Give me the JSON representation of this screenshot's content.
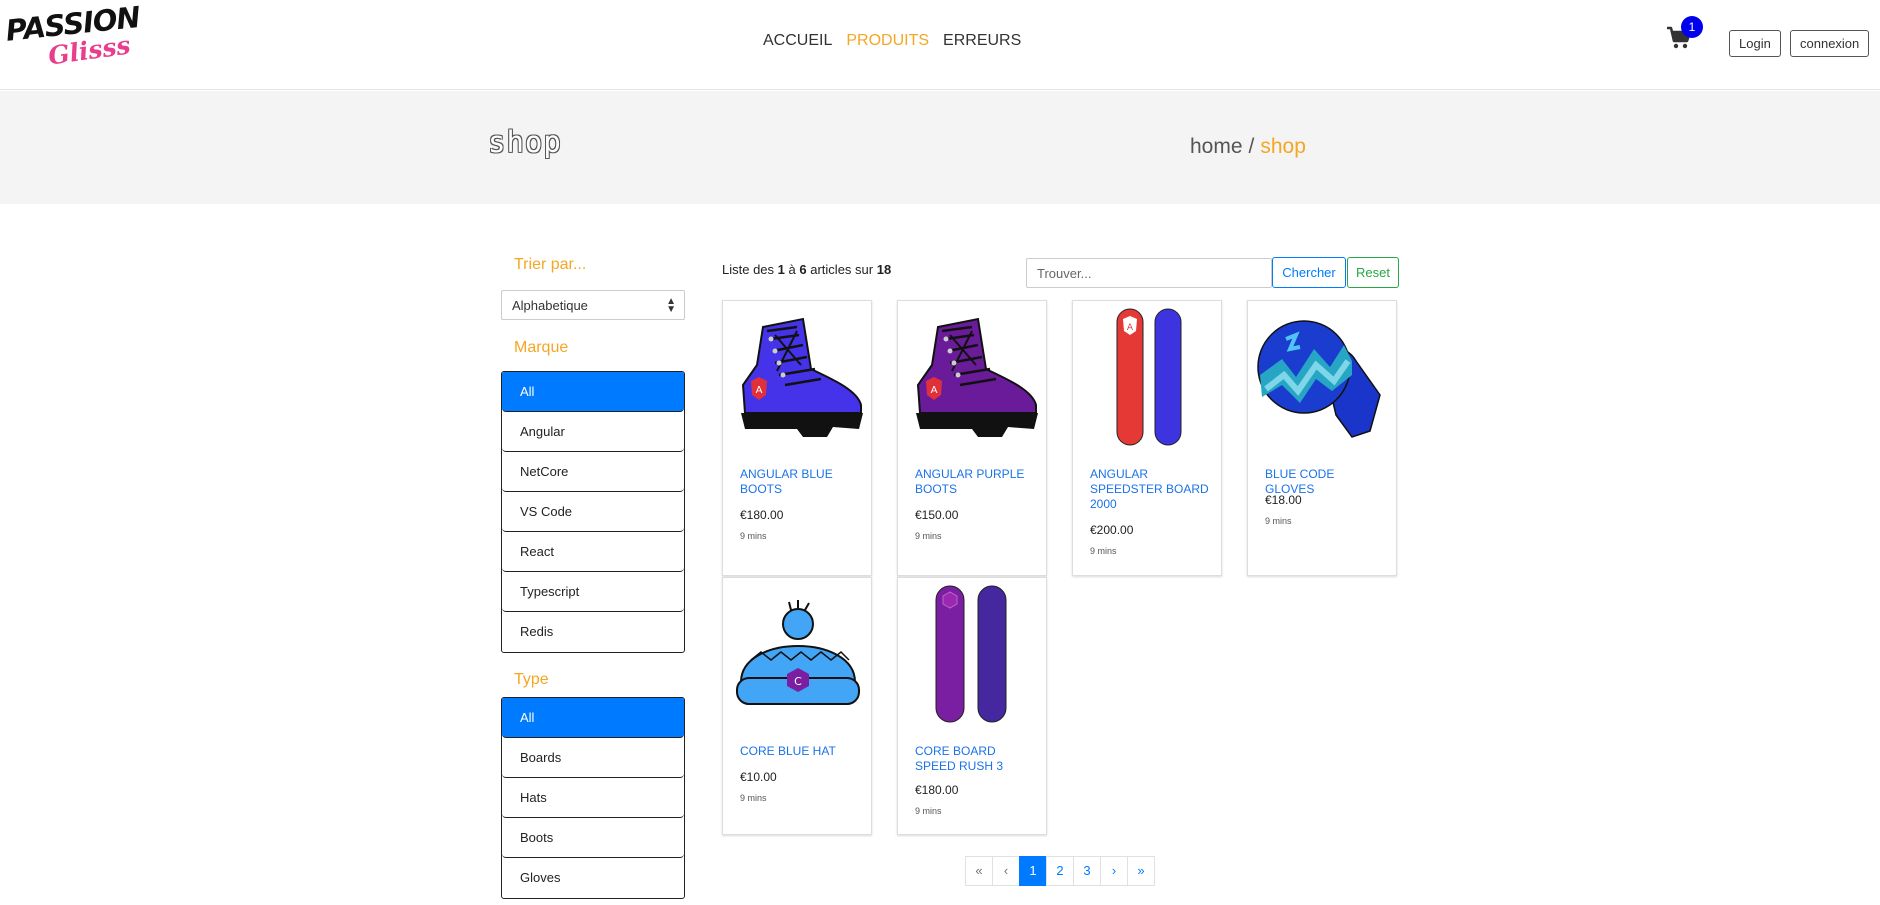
{
  "header": {
    "logo_line1": "PASSION",
    "logo_line2": "Glisss",
    "nav": [
      "ACCUEIL",
      "PRODUITS",
      "ERREURS"
    ],
    "active_nav": "PRODUITS",
    "cart_count": "1",
    "login_label": "Login",
    "connexion_label": "connexion"
  },
  "banner": {
    "title": "shop",
    "breadcrumb_home": "home",
    "breadcrumb_sep": "/",
    "breadcrumb_current": "shop"
  },
  "sidebar": {
    "sort_heading": "Trier par...",
    "sort_value": "Alphabetique",
    "brand_heading": "Marque",
    "brands": [
      "All",
      "Angular",
      "NetCore",
      "VS Code",
      "React",
      "Typescript",
      "Redis"
    ],
    "brand_selected": "All",
    "type_heading": "Type",
    "types": [
      "All",
      "Boards",
      "Hats",
      "Boots",
      "Gloves"
    ],
    "type_selected": "All"
  },
  "main": {
    "summary_prefix": "Liste des",
    "summary_from": "1",
    "summary_mid": "à",
    "summary_to": "6",
    "summary_mid2": "articles sur",
    "summary_total": "18",
    "search_placeholder": "Trouver...",
    "search_button": "Chercher",
    "reset_button": "Reset",
    "products": [
      {
        "name": "ANGULAR BLUE BOOTS",
        "price": "€180.00",
        "meta": "9 mins",
        "icon": "blue-boot-image"
      },
      {
        "name": "ANGULAR PURPLE BOOTS",
        "price": "€150.00",
        "meta": "9 mins",
        "icon": "purple-boot-image"
      },
      {
        "name": "ANGULAR SPEEDSTER BOARD 2000",
        "price": "€200.00",
        "meta": "9 mins",
        "icon": "red-blue-board-image"
      },
      {
        "name": "BLUE CODE GLOVES",
        "price": "€18.00",
        "meta": "9 mins",
        "icon": "blue-glove-image"
      },
      {
        "name": "CORE BLUE HAT",
        "price": "€10.00",
        "meta": "9 mins",
        "icon": "blue-hat-image"
      },
      {
        "name": "CORE BOARD SPEED RUSH 3",
        "price": "€180.00",
        "meta": "9 mins",
        "icon": "purple-board-image"
      }
    ],
    "pagination": [
      "«",
      "‹",
      "1",
      "2",
      "3",
      "›",
      "»"
    ],
    "current_page": "1"
  },
  "colors": {
    "accent": "#f5a623",
    "primary": "#007bff",
    "success": "#28a745",
    "badge": "#0000ee",
    "logo_pink": "#e83e8c"
  }
}
